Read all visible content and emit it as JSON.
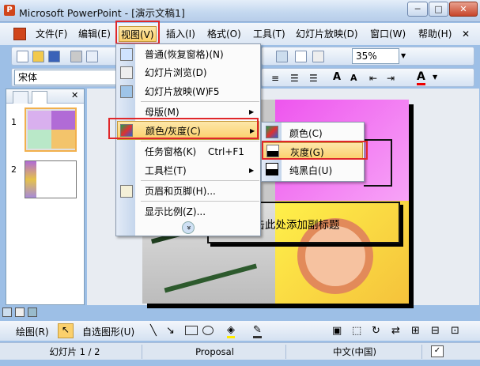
{
  "window": {
    "title": "Microsoft PowerPoint - [演示文稿1]",
    "minimize": "─",
    "maximize": "□",
    "close": "✕"
  },
  "menubar": {
    "items": [
      "文件(F)",
      "编辑(E)",
      "视图(V)",
      "插入(I)",
      "格式(O)",
      "工具(T)",
      "幻灯片放映(D)",
      "窗口(W)",
      "帮助(H)"
    ],
    "close": "✕"
  },
  "toolbar": {
    "font_name": "宋体",
    "zoom": "35%"
  },
  "thumbnails": [
    {
      "num": "1"
    },
    {
      "num": "2"
    }
  ],
  "slide": {
    "subtitle": "单击此处添加副标题"
  },
  "view_menu": {
    "items": [
      {
        "label": "普通(恢复窗格)(N)",
        "shortcut": "",
        "submenu": false
      },
      {
        "label": "幻灯片浏览(D)",
        "shortcut": "",
        "submenu": false
      },
      {
        "label": "幻灯片放映(W)",
        "shortcut": "F5",
        "submenu": false
      },
      {
        "label": "母版(M)",
        "shortcut": "",
        "submenu": true
      },
      {
        "label": "颜色/灰度(C)",
        "shortcut": "",
        "submenu": true
      },
      {
        "label": "任务窗格(K)",
        "shortcut": "Ctrl+F1",
        "submenu": false
      },
      {
        "label": "工具栏(T)",
        "shortcut": "",
        "submenu": true
      },
      {
        "label": "页眉和页脚(H)...",
        "shortcut": "",
        "submenu": false
      },
      {
        "label": "显示比例(Z)...",
        "shortcut": "",
        "submenu": false
      }
    ],
    "expand": "»"
  },
  "color_submenu": {
    "items": [
      "颜色(C)",
      "灰度(G)",
      "纯黑白(U)"
    ]
  },
  "drawing_toolbar": {
    "draw": "绘图(R)",
    "autoshapes": "自选图形(U)"
  },
  "statusbar": {
    "slide": "幻灯片 1 / 2",
    "design": "Proposal",
    "language": "中文(中国)"
  },
  "colors": {
    "accent": "#e0272a",
    "highlight": "#fbd06c",
    "titlebar": "#c3d7ef"
  }
}
